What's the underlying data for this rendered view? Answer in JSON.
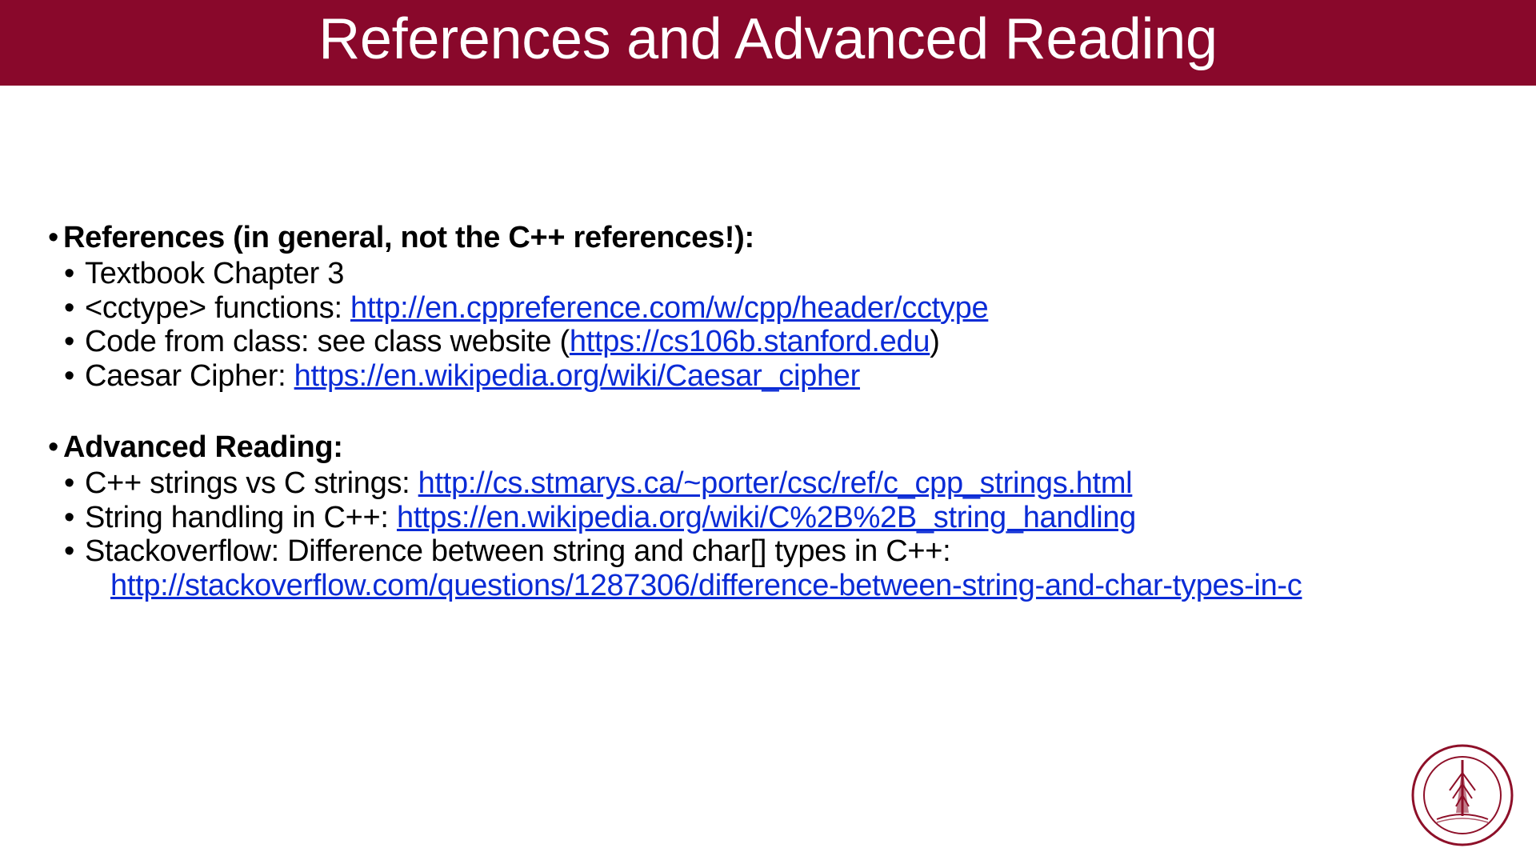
{
  "title": "References and Advanced Reading",
  "sections": {
    "references": {
      "heading": "References (in general, not the C++ references!):",
      "items": {
        "0": {
          "text": "Textbook Chapter 3"
        },
        "1": {
          "prefix": "<cctype> functions: ",
          "link": "http://en.cppreference.com/w/cpp/header/cctype"
        },
        "2": {
          "prefix": "Code from class: see class website (",
          "link": "https://cs106b.stanford.edu",
          "suffix": ")"
        },
        "3": {
          "prefix": "Caesar Cipher: ",
          "link": "https://en.wikipedia.org/wiki/Caesar_cipher"
        }
      }
    },
    "advanced": {
      "heading": "Advanced Reading:",
      "items": {
        "0": {
          "prefix": " C++ strings vs C strings: ",
          "link": "http://cs.stmarys.ca/~porter/csc/ref/c_cpp_strings.html"
        },
        "1": {
          "prefix": " String handling in C++: ",
          "link": "https://en.wikipedia.org/wiki/C%2B%2B_string_handling"
        },
        "2": {
          "prefix": " Stackoverflow: Difference between string and char[] types in C++:",
          "link": "http://stackoverflow.com/questions/1287306/difference-between-string-and-char-types-in-c"
        }
      }
    }
  },
  "logo": {
    "alt": "stanford-seal"
  }
}
